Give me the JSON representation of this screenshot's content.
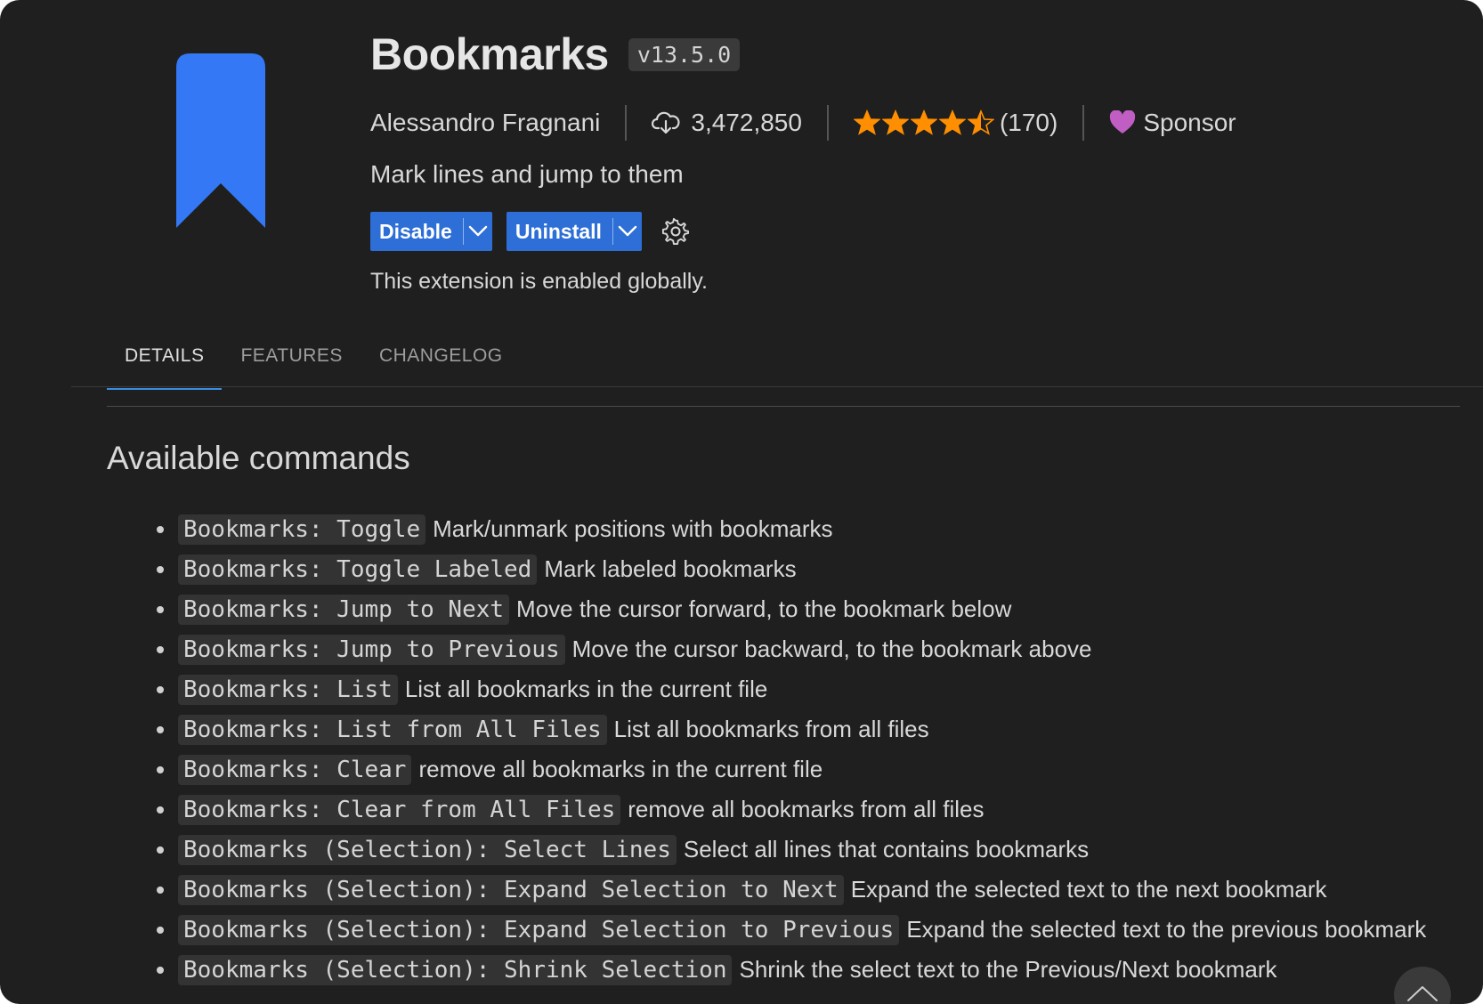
{
  "extension": {
    "name": "Bookmarks",
    "version": "v13.5.0",
    "publisher": "Alessandro Fragnani",
    "installs": "3,472,850",
    "rating_stars": 4.5,
    "rating_count": "(170)",
    "sponsor_label": "Sponsor",
    "description": "Mark lines and jump to them",
    "status": "This extension is enabled globally."
  },
  "actions": {
    "disable_label": "Disable",
    "uninstall_label": "Uninstall"
  },
  "tabs": [
    {
      "label": "DETAILS",
      "active": true
    },
    {
      "label": "FEATURES",
      "active": false
    },
    {
      "label": "CHANGELOG",
      "active": false
    }
  ],
  "content": {
    "section_title": "Available commands",
    "commands": [
      {
        "code": "Bookmarks: Toggle",
        "desc": "Mark/unmark positions with bookmarks"
      },
      {
        "code": "Bookmarks: Toggle Labeled",
        "desc": "Mark labeled bookmarks"
      },
      {
        "code": "Bookmarks: Jump to Next",
        "desc": "Move the cursor forward, to the bookmark below"
      },
      {
        "code": "Bookmarks: Jump to Previous",
        "desc": "Move the cursor backward, to the bookmark above"
      },
      {
        "code": "Bookmarks: List",
        "desc": "List all bookmarks in the current file"
      },
      {
        "code": "Bookmarks: List from All Files",
        "desc": "List all bookmarks from all files"
      },
      {
        "code": "Bookmarks: Clear",
        "desc": "remove all bookmarks in the current file"
      },
      {
        "code": "Bookmarks: Clear from All Files",
        "desc": "remove all bookmarks from all files"
      },
      {
        "code": "Bookmarks (Selection): Select Lines",
        "desc": "Select all lines that contains bookmarks"
      },
      {
        "code": "Bookmarks (Selection): Expand Selection to Next",
        "desc": "Expand the selected text to the next bookmark"
      },
      {
        "code": "Bookmarks (Selection): Expand Selection to Previous",
        "desc": "Expand the selected text to the previous bookmark"
      },
      {
        "code": "Bookmarks (Selection): Shrink Selection",
        "desc": "Shrink the select text to the Previous/Next bookmark"
      }
    ]
  },
  "colors": {
    "background": "#1f1f1f",
    "button": "#2d6fd6",
    "star": "#ff8e00",
    "heart": "#c05ec4",
    "logo": "#3478f6",
    "tab_underline": "#3b8de0"
  },
  "icons": {
    "logo": "bookmark-icon",
    "installs": "cloud-download-icon",
    "sponsor": "heart-icon",
    "settings": "gear-icon",
    "scroll": "chevron-up-icon"
  }
}
